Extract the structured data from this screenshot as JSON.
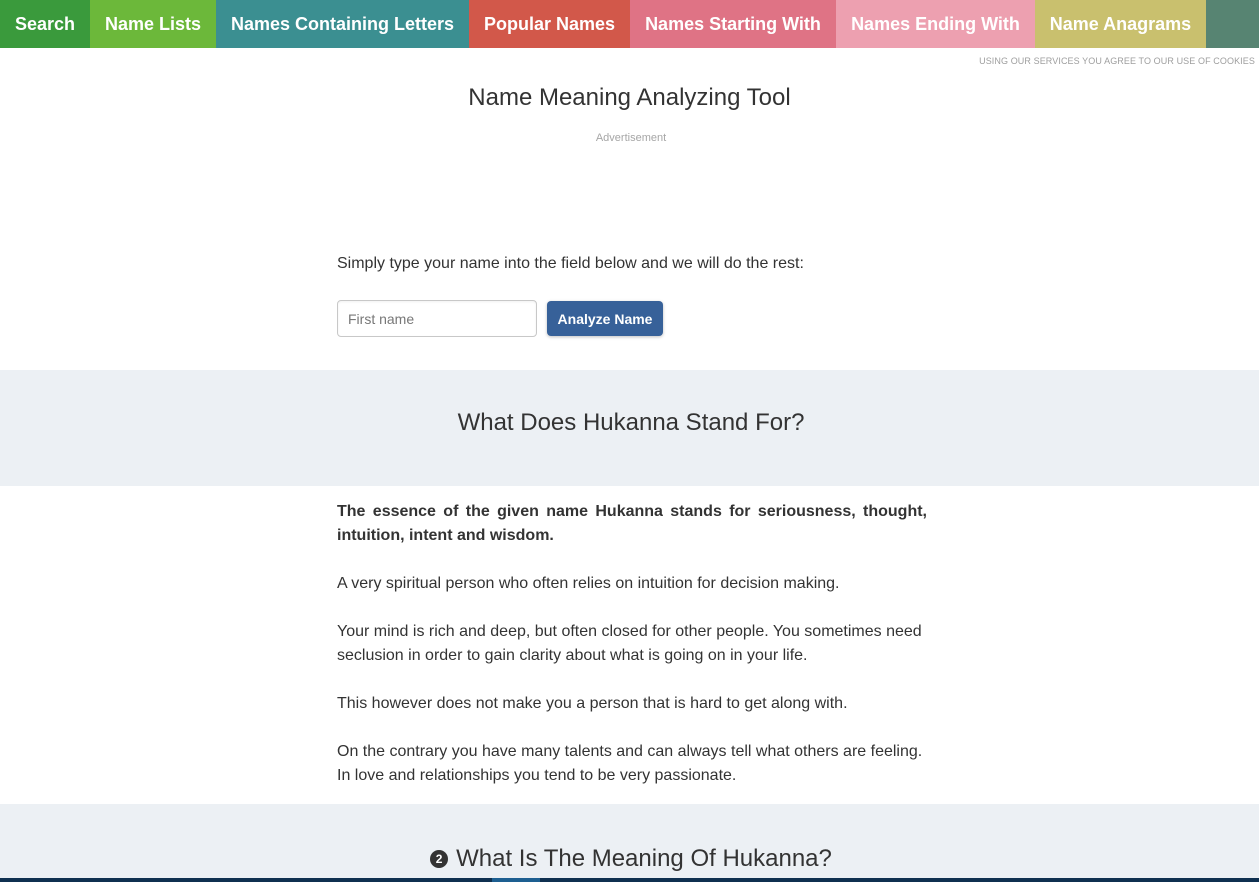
{
  "nav": {
    "items": [
      {
        "label": "Search"
      },
      {
        "label": "Name Lists"
      },
      {
        "label": "Names Containing Letters"
      },
      {
        "label": "Popular Names"
      },
      {
        "label": "Names Starting With"
      },
      {
        "label": "Names Ending With"
      },
      {
        "label": "Name Anagrams"
      }
    ]
  },
  "cookie_notice": "USING OUR SERVICES YOU AGREE TO OUR USE OF COOKIES",
  "tool": {
    "title": "Name Meaning Analyzing Tool",
    "ad_label": "Advertisement",
    "instruction": "Simply type your name into the field below and we will do the rest:",
    "input_placeholder": "First name",
    "input_value": "",
    "button_label": "Analyze Name"
  },
  "section1": {
    "heading": "What Does Hukanna Stand For?",
    "paragraphs": [
      "The essence of the given name Hukanna stands for seriousness, thought, intuition, intent and wisdom.",
      "A very spiritual person who often relies on intuition for decision making.",
      "Your mind is rich and deep, but often closed for other people. You sometimes need seclusion in order to gain clarity about what is going on in your life.",
      "This however does not make you a person that is hard to get along with.",
      "On the contrary you have many talents and can always tell what others are feeling. In love and relationships you tend to be very passionate."
    ]
  },
  "section2": {
    "badge": "2",
    "heading": "What Is The Meaning Of Hukanna?"
  },
  "colors": {
    "search": "#3a9a3c",
    "name_lists": "#6cb83a",
    "containing": "#3b8f91",
    "popular": "#d2584a",
    "starting": "#df7385",
    "ending": "#eda0b0",
    "anagrams": "#c9c06e",
    "nav_tail": "#578472",
    "button": "#376199",
    "band": "#ecf0f4"
  }
}
